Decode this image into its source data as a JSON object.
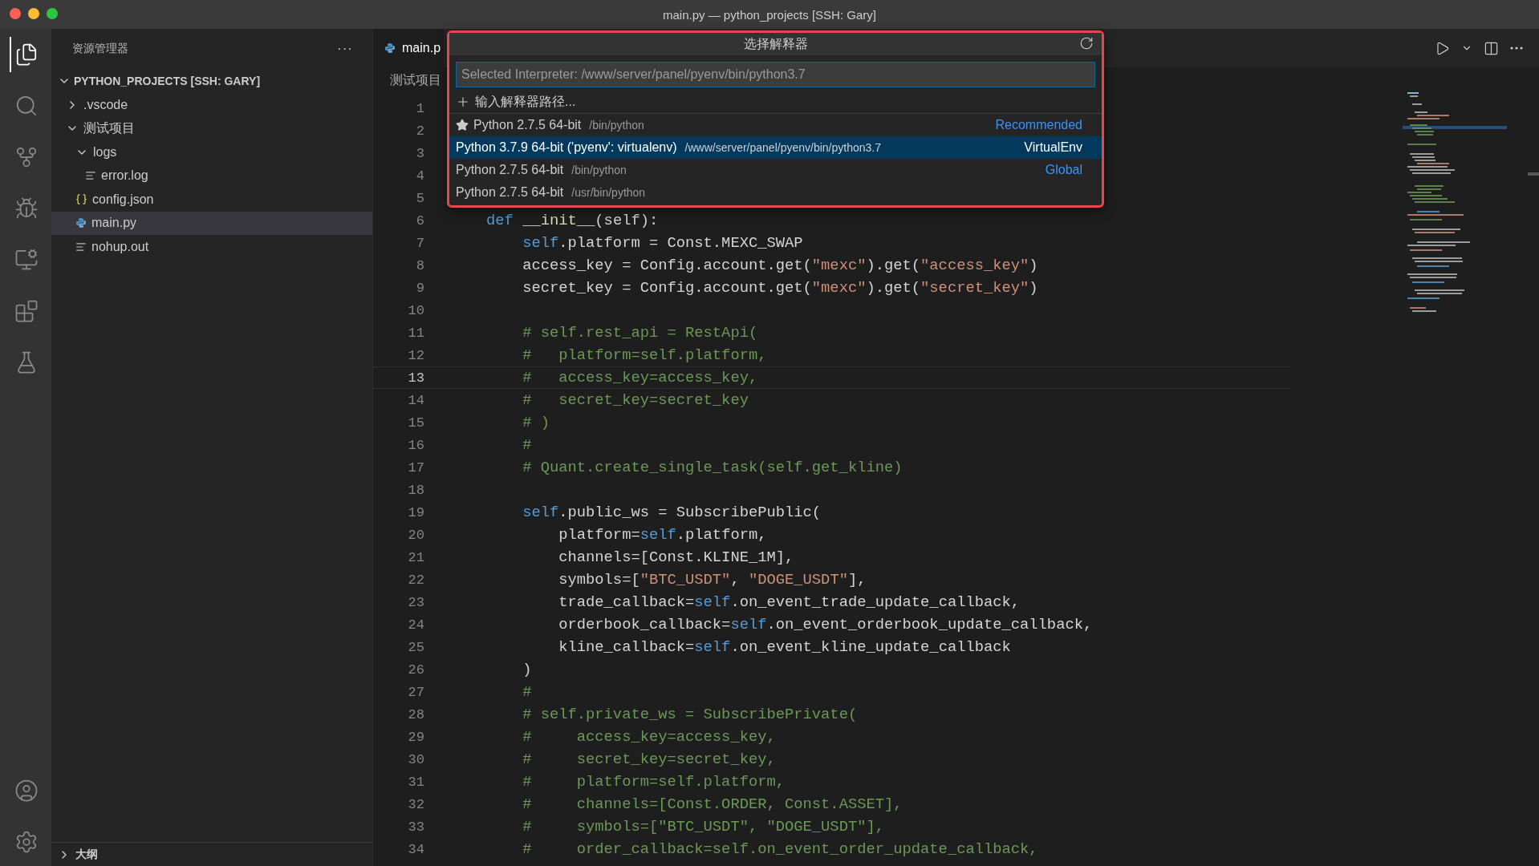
{
  "window": {
    "title": "main.py — python_projects [SSH: Gary]"
  },
  "activity_bar": {
    "top": [
      {
        "selected": true
      },
      {
        "selected": false
      },
      {
        "selected": false
      },
      {
        "selected": false
      },
      {
        "selected": false
      },
      {
        "selected": false
      },
      {
        "selected": false
      }
    ]
  },
  "sidebar": {
    "title": "资源管理器",
    "more": "···",
    "section": {
      "label": "PYTHON_PROJECTS [SSH: GARY]",
      "expanded": true
    },
    "tree": [
      {
        "label": ".vscode",
        "kind": "folder",
        "expanded": false,
        "selected": false
      },
      {
        "label": "测试项目",
        "kind": "folder",
        "expanded": true,
        "selected": false,
        "children": [
          {
            "label": "logs",
            "kind": "folder",
            "expanded": true,
            "selected": false,
            "children": [
              {
                "label": "error.log",
                "kind": "text",
                "selected": false
              }
            ]
          },
          {
            "label": "config.json",
            "kind": "json",
            "selected": false
          },
          {
            "label": "main.py",
            "kind": "python",
            "selected": true
          },
          {
            "label": "nohup.out",
            "kind": "text",
            "selected": false
          }
        ]
      }
    ],
    "outline": {
      "label": "大纲",
      "expanded": false
    }
  },
  "editor": {
    "tab": {
      "label": "main.p",
      "selected": true
    },
    "breadcrumb": "测试项目",
    "lines": [
      {
        "number": "1",
        "current": false
      },
      {
        "number": "2",
        "current": false
      },
      {
        "number": "3",
        "current": false
      },
      {
        "number": "4",
        "current": false
      },
      {
        "number": "5",
        "current": false
      },
      {
        "number": "6",
        "current": false,
        "tokens": [
          {
            "kind": "keyword",
            "text": "    def"
          },
          {
            "kind": "function",
            "text": " __init__"
          },
          {
            "kind": "plain",
            "text": "(self):"
          }
        ]
      },
      {
        "number": "7",
        "current": false,
        "tokens": [
          {
            "kind": "self",
            "text": "        self"
          },
          {
            "kind": "plain",
            "text": ".platform = Const.MEXC_SWAP"
          }
        ]
      },
      {
        "number": "8",
        "current": false,
        "tokens": [
          {
            "kind": "plain",
            "text": "        access_key = Config.account.get("
          },
          {
            "kind": "string",
            "text": "\"mexc\""
          },
          {
            "kind": "plain",
            "text": ").get("
          },
          {
            "kind": "string",
            "text": "\"access_key\""
          },
          {
            "kind": "plain",
            "text": ")"
          }
        ]
      },
      {
        "number": "9",
        "current": false,
        "tokens": [
          {
            "kind": "plain",
            "text": "        secret_key = Config.account.get("
          },
          {
            "kind": "string",
            "text": "\"mexc\""
          },
          {
            "kind": "plain",
            "text": ").get("
          },
          {
            "kind": "string",
            "text": "\"secret_key\""
          },
          {
            "kind": "plain",
            "text": ")"
          }
        ]
      },
      {
        "number": "10",
        "current": false
      },
      {
        "number": "11",
        "current": false,
        "tokens": [
          {
            "kind": "comment",
            "text": "        # self.rest_api = RestApi("
          }
        ]
      },
      {
        "number": "12",
        "current": false,
        "tokens": [
          {
            "kind": "comment",
            "text": "        #   platform=self.platform,"
          }
        ]
      },
      {
        "number": "13",
        "current": true,
        "tokens": [
          {
            "kind": "comment",
            "text": "        #   access_key=access_key,"
          }
        ]
      },
      {
        "number": "14",
        "current": false,
        "tokens": [
          {
            "kind": "comment",
            "text": "        #   secret_key=secret_key"
          }
        ]
      },
      {
        "number": "15",
        "current": false,
        "tokens": [
          {
            "kind": "comment",
            "text": "        # )"
          }
        ]
      },
      {
        "number": "16",
        "current": false,
        "tokens": [
          {
            "kind": "comment",
            "text": "        #"
          }
        ]
      },
      {
        "number": "17",
        "current": false,
        "tokens": [
          {
            "kind": "comment",
            "text": "        # Quant.create_single_task(self.get_kline)"
          }
        ]
      },
      {
        "number": "18",
        "current": false
      },
      {
        "number": "19",
        "current": false,
        "tokens": [
          {
            "kind": "self",
            "text": "        self"
          },
          {
            "kind": "plain",
            "text": ".public_ws = SubscribePublic("
          }
        ]
      },
      {
        "number": "20",
        "current": false,
        "tokens": [
          {
            "kind": "plain",
            "text": "            platform="
          },
          {
            "kind": "self",
            "text": "self"
          },
          {
            "kind": "plain",
            "text": ".platform,"
          }
        ]
      },
      {
        "number": "21",
        "current": false,
        "tokens": [
          {
            "kind": "plain",
            "text": "            channels=[Const.KLINE_1M],"
          }
        ]
      },
      {
        "number": "22",
        "current": false,
        "tokens": [
          {
            "kind": "plain",
            "text": "            symbols=["
          },
          {
            "kind": "string",
            "text": "\"BTC_USDT\""
          },
          {
            "kind": "plain",
            "text": ", "
          },
          {
            "kind": "string",
            "text": "\"DOGE_USDT\""
          },
          {
            "kind": "plain",
            "text": "],"
          }
        ]
      },
      {
        "number": "23",
        "current": false,
        "tokens": [
          {
            "kind": "plain",
            "text": "            trade_callback="
          },
          {
            "kind": "self",
            "text": "self"
          },
          {
            "kind": "plain",
            "text": ".on_event_trade_update_callback,"
          }
        ]
      },
      {
        "number": "24",
        "current": false,
        "tokens": [
          {
            "kind": "plain",
            "text": "            orderbook_callback="
          },
          {
            "kind": "self",
            "text": "self"
          },
          {
            "kind": "plain",
            "text": ".on_event_orderbook_update_callback,"
          }
        ]
      },
      {
        "number": "25",
        "current": false,
        "tokens": [
          {
            "kind": "plain",
            "text": "            kline_callback="
          },
          {
            "kind": "self",
            "text": "self"
          },
          {
            "kind": "plain",
            "text": ".on_event_kline_update_callback"
          }
        ]
      },
      {
        "number": "26",
        "current": false,
        "tokens": [
          {
            "kind": "plain",
            "text": "        )"
          }
        ]
      },
      {
        "number": "27",
        "current": false,
        "tokens": [
          {
            "kind": "comment",
            "text": "        #"
          }
        ]
      },
      {
        "number": "28",
        "current": false,
        "tokens": [
          {
            "kind": "comment",
            "text": "        # self.private_ws = SubscribePrivate("
          }
        ]
      },
      {
        "number": "29",
        "current": false,
        "tokens": [
          {
            "kind": "comment",
            "text": "        #     access_key=access_key,"
          }
        ]
      },
      {
        "number": "30",
        "current": false,
        "tokens": [
          {
            "kind": "comment",
            "text": "        #     secret_key=secret_key,"
          }
        ]
      },
      {
        "number": "31",
        "current": false,
        "tokens": [
          {
            "kind": "comment",
            "text": "        #     platform=self.platform,"
          }
        ]
      },
      {
        "number": "32",
        "current": false,
        "tokens": [
          {
            "kind": "comment",
            "text": "        #     channels=[Const.ORDER, Const.ASSET],"
          }
        ]
      },
      {
        "number": "33",
        "current": false,
        "tokens": [
          {
            "kind": "comment",
            "text": "        #     symbols=[\"BTC_USDT\", \"DOGE_USDT\"],"
          }
        ]
      },
      {
        "number": "34",
        "current": false,
        "tokens": [
          {
            "kind": "comment",
            "text": "        #     order_callback=self.on_event_order_update_callback,"
          }
        ]
      }
    ]
  },
  "quick_pick": {
    "title": "选择解释器",
    "input": {
      "placeholder": "Selected Interpreter: /www/server/panel/pyenv/bin/python3.7"
    },
    "items": [
      {
        "kind": "action",
        "label": "输入解释器路径...",
        "selected": false
      },
      {
        "kind": "interpreter",
        "starred": true,
        "label": "Python 2.7.5 64-bit",
        "path": "/bin/python",
        "tag": "Recommended",
        "selected": false
      },
      {
        "kind": "interpreter",
        "starred": false,
        "label": "Python 3.7.9 64-bit ('pyenv': virtualenv)",
        "path": "/www/server/panel/pyenv/bin/python3.7",
        "tag": "VirtualEnv",
        "selected": true
      },
      {
        "kind": "interpreter",
        "starred": false,
        "label": "Python 2.7.5 64-bit",
        "path": "/bin/python",
        "tag": "Global",
        "selected": false
      },
      {
        "kind": "interpreter",
        "starred": false,
        "label": "Python 2.7.5 64-bit",
        "path": "/usr/bin/python",
        "selected": false
      }
    ]
  }
}
